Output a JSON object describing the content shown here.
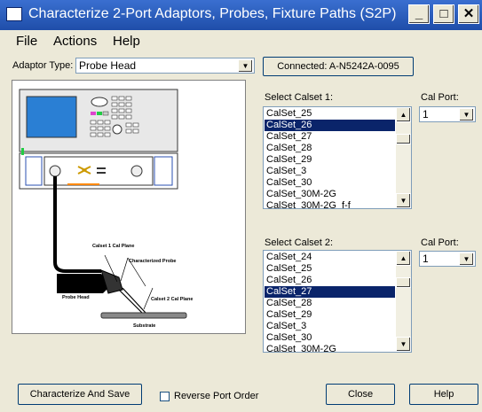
{
  "window": {
    "title": "Characterize 2-Port Adaptors, Probes, Fixture Paths (S2P)"
  },
  "titlebar_buttons": {
    "minimize": "_",
    "maximize": "□",
    "close": "✕"
  },
  "menu": [
    "File",
    "Actions",
    "Help"
  ],
  "adaptor": {
    "label": "Adaptor Type:",
    "value": "Probe Head"
  },
  "connected_button": "Connected: A-N5242A-0095",
  "calset1": {
    "label": "Select Calset 1:",
    "items": [
      "CalSet_25",
      "CalSet_26",
      "CalSet_27",
      "CalSet_28",
      "CalSet_29",
      "CalSet_3",
      "CalSet_30",
      "CalSet_30M-2G",
      "CalSet_30M-2G_f-f"
    ],
    "selected_index": 1
  },
  "calport1": {
    "label": "Cal Port:",
    "value": "1"
  },
  "calset2": {
    "label": "Select Calset 2:",
    "items": [
      "CalSet_24",
      "CalSet_25",
      "CalSet_26",
      "CalSet_27",
      "CalSet_28",
      "CalSet_29",
      "CalSet_3",
      "CalSet_30",
      "CalSet_30M-2G"
    ],
    "selected_index": 3
  },
  "calport2": {
    "label": "Cal Port:",
    "value": "1"
  },
  "diagram": {
    "calset1_plane": "Calset 1 Cal Plane",
    "characterized_probe": "Characterized Probe",
    "probe_head": "Probe Head",
    "calset2_plane": "Calset 2 Cal Plane",
    "substrate": "Substrate"
  },
  "buttons": {
    "characterize": "Characterize And Save",
    "close": "Close",
    "help": "Help"
  },
  "reverse_port_order": {
    "label": "Reverse Port Order",
    "checked": false
  },
  "icons": {
    "dropdown": "▼",
    "scroll_up": "▲",
    "scroll_down": "▼"
  },
  "colors": {
    "title_bar": "#2b5fc4",
    "selection": "#0a246a",
    "dialog": "#ece9d8"
  }
}
